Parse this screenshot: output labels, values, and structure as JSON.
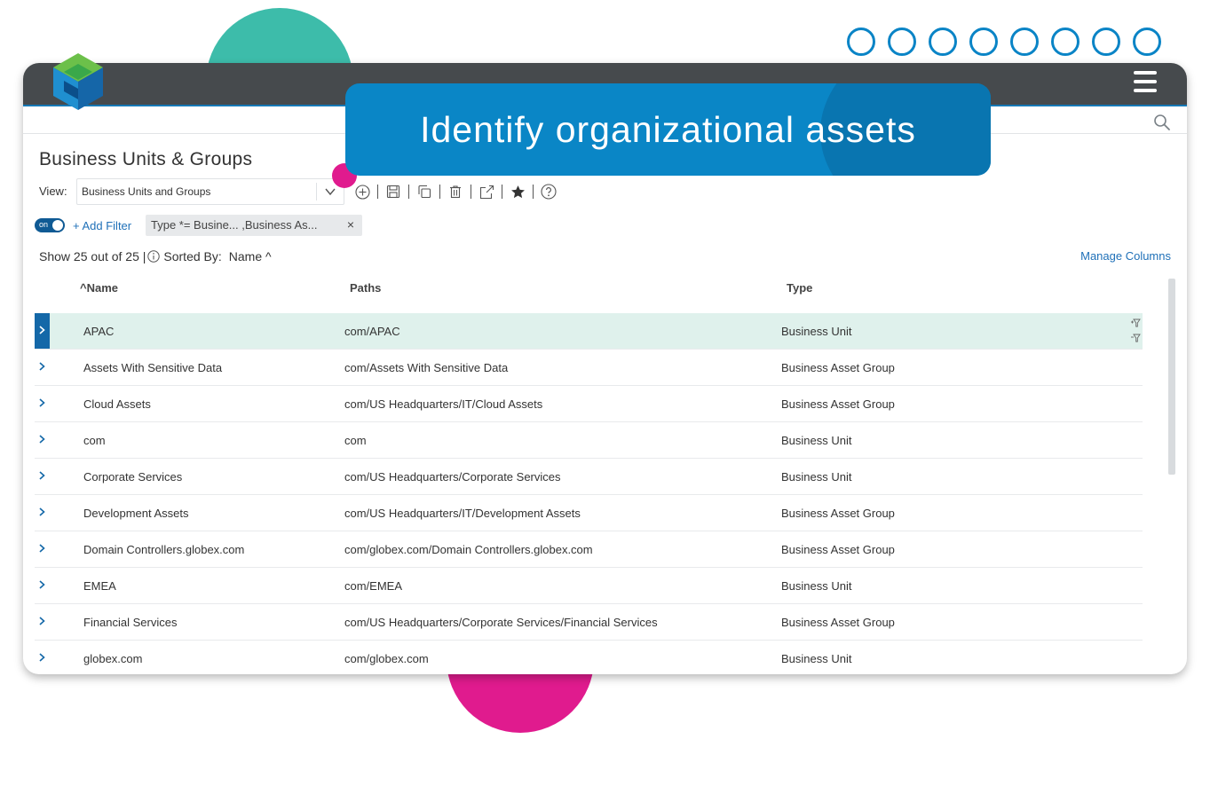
{
  "banner": {
    "text": "Identify organizational assets"
  },
  "page": {
    "title": "Business Units & Groups"
  },
  "view": {
    "label": "View:",
    "selected": "Business Units and Groups"
  },
  "filters": {
    "toggle_label": "on",
    "add_filter": "+ Add Filter",
    "chip_text": "Type *= Busine... ,Business As...",
    "chip_remove": "×"
  },
  "status": {
    "show_text": "Show 25 out of 25 |",
    "sorted_by": "Sorted By:",
    "sort_field": "Name ^",
    "manage_columns": "Manage Columns"
  },
  "table": {
    "columns": {
      "name": "^Name",
      "paths": "Paths",
      "type": "Type"
    },
    "rows": [
      {
        "name": "APAC",
        "path": "com/APAC",
        "type": "Business Unit",
        "selected": true
      },
      {
        "name": "Assets With Sensitive Data",
        "path": "com/Assets With Sensitive Data",
        "type": "Business Asset Group"
      },
      {
        "name": "Cloud Assets",
        "path": "com/US Headquarters/IT/Cloud Assets",
        "type": "Business Asset Group"
      },
      {
        "name": "com",
        "path": "com",
        "type": "Business Unit"
      },
      {
        "name": "Corporate Services",
        "path": "com/US Headquarters/Corporate Services",
        "type": "Business Unit"
      },
      {
        "name": "Development Assets",
        "path": "com/US Headquarters/IT/Development Assets",
        "type": "Business Asset Group"
      },
      {
        "name": "Domain Controllers.globex.com",
        "path": "com/globex.com/Domain Controllers.globex.com",
        "type": "Business Asset Group"
      },
      {
        "name": "EMEA",
        "path": "com/EMEA",
        "type": "Business Unit"
      },
      {
        "name": "Financial Services",
        "path": "com/US Headquarters/Corporate Services/Financial Services",
        "type": "Business Asset Group"
      },
      {
        "name": "globex.com",
        "path": "com/globex.com",
        "type": "Business Unit"
      }
    ]
  },
  "icons": {
    "toolbar": [
      "add-circle-icon",
      "save-icon",
      "copy-icon",
      "trash-icon",
      "share-icon",
      "star-icon",
      "help-icon"
    ],
    "header": [
      "hamburger-menu-icon",
      "search-icon",
      "app-logo-icon"
    ]
  },
  "colors": {
    "topbar": "#464a4d",
    "banner": "#0a86c6",
    "accent_blue": "#1f70b8",
    "selected_row": "#dff1ec",
    "teal_deco": "#3dbcaa",
    "pink_deco": "#e01b8e"
  }
}
